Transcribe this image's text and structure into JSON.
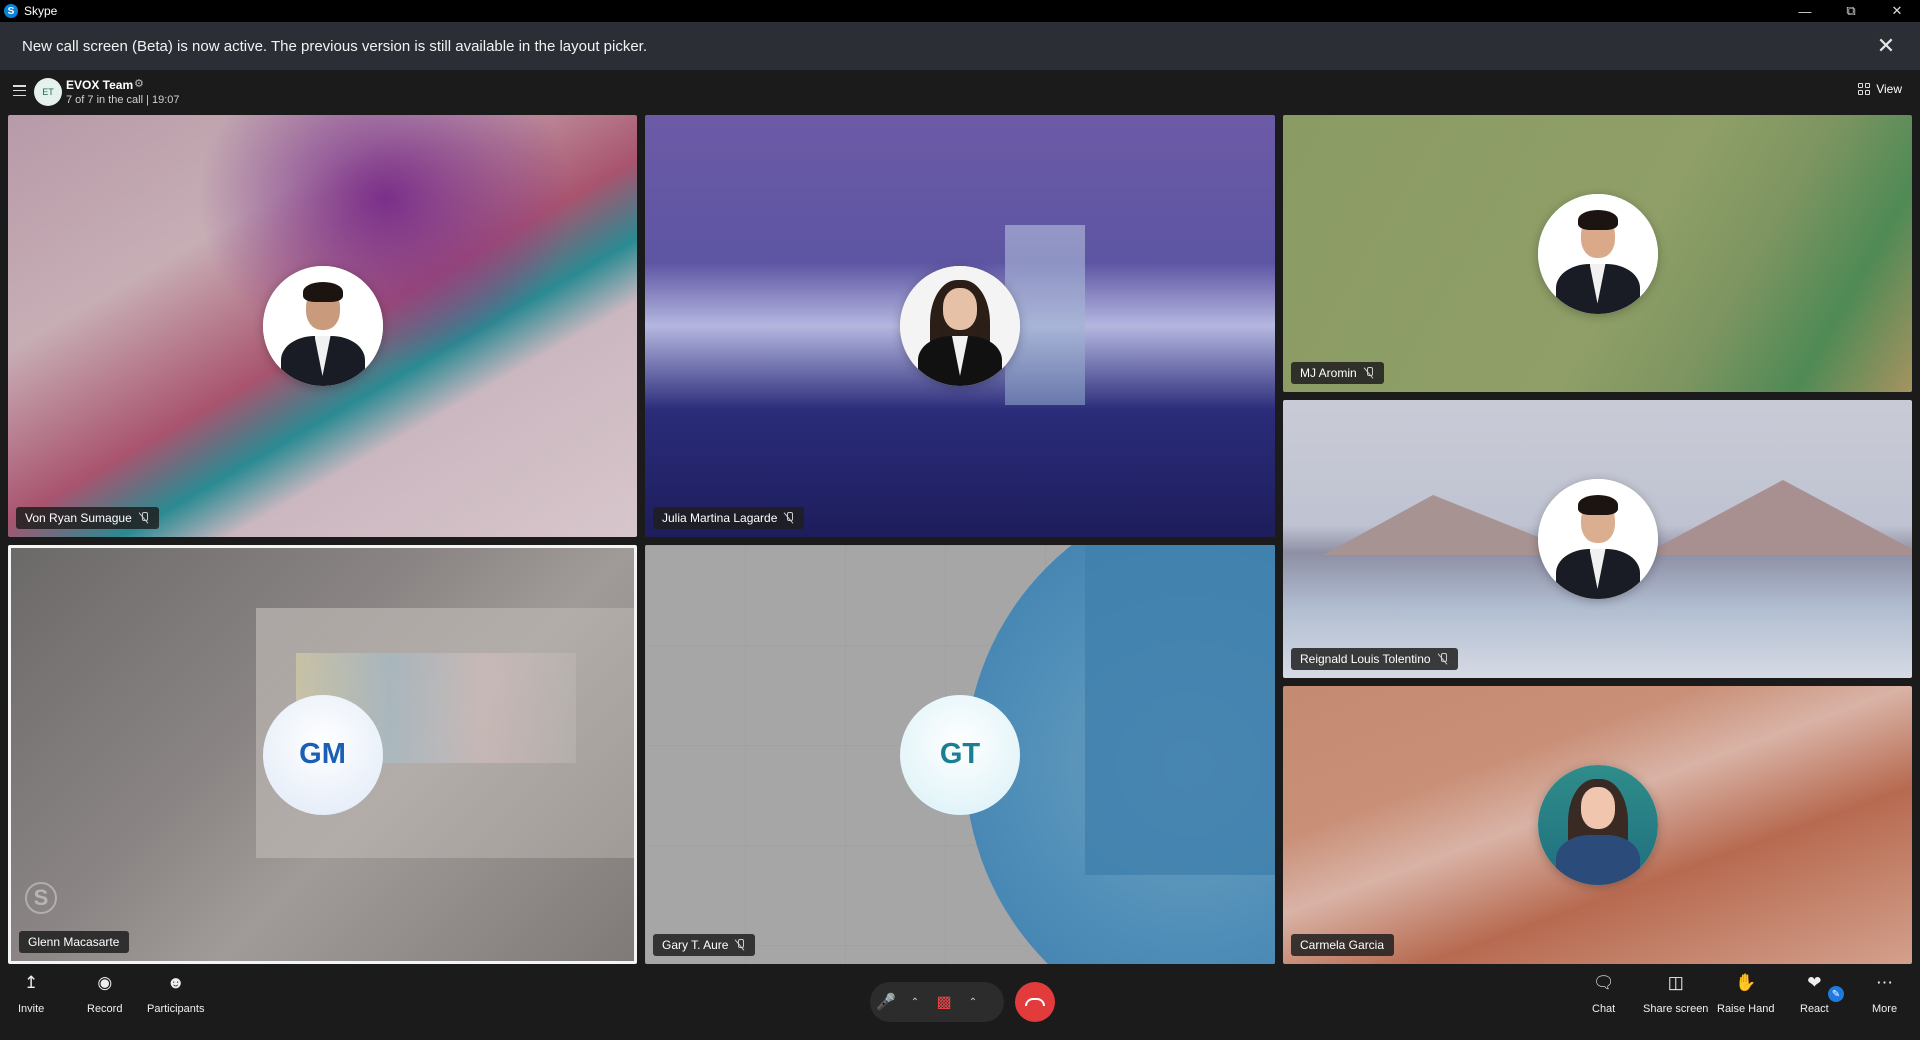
{
  "window": {
    "app_title": "Skype",
    "logo_letter": "S"
  },
  "banner": {
    "message": "New call screen (Beta) is now active. The previous version is still available in the layout picker."
  },
  "header": {
    "group_initials": "ET",
    "group_name": "EVOX Team",
    "call_status": "7 of 7 in the call | 19:07",
    "view_label": "View"
  },
  "participants": [
    {
      "name": "Von Ryan Sumague",
      "muted": true,
      "has_photo": true
    },
    {
      "name": "Julia Martina Lagarde",
      "muted": true,
      "has_photo": true
    },
    {
      "name": "MJ Aromin",
      "muted": true,
      "has_photo": true
    },
    {
      "name": "Reignald Louis Tolentino",
      "muted": true,
      "has_photo": true
    },
    {
      "name": "Glenn Macasarte",
      "muted": false,
      "initials": "GM",
      "active_speaker": true
    },
    {
      "name": "Gary T. Aure",
      "muted": true,
      "initials": "GT"
    },
    {
      "name": "Carmela Garcia",
      "muted": false,
      "has_photo": true
    }
  ],
  "toolbar": {
    "invite": "Invite",
    "record": "Record",
    "participants": "Participants",
    "chat": "Chat",
    "share_screen": "Share screen",
    "raise_hand": "Raise Hand",
    "react": "React",
    "more": "More"
  },
  "colors": {
    "accent": "#1f7ae0",
    "hangup": "#e23b3b",
    "banner_bg": "#2b2f35",
    "initials_text": "#1a5fb4"
  }
}
